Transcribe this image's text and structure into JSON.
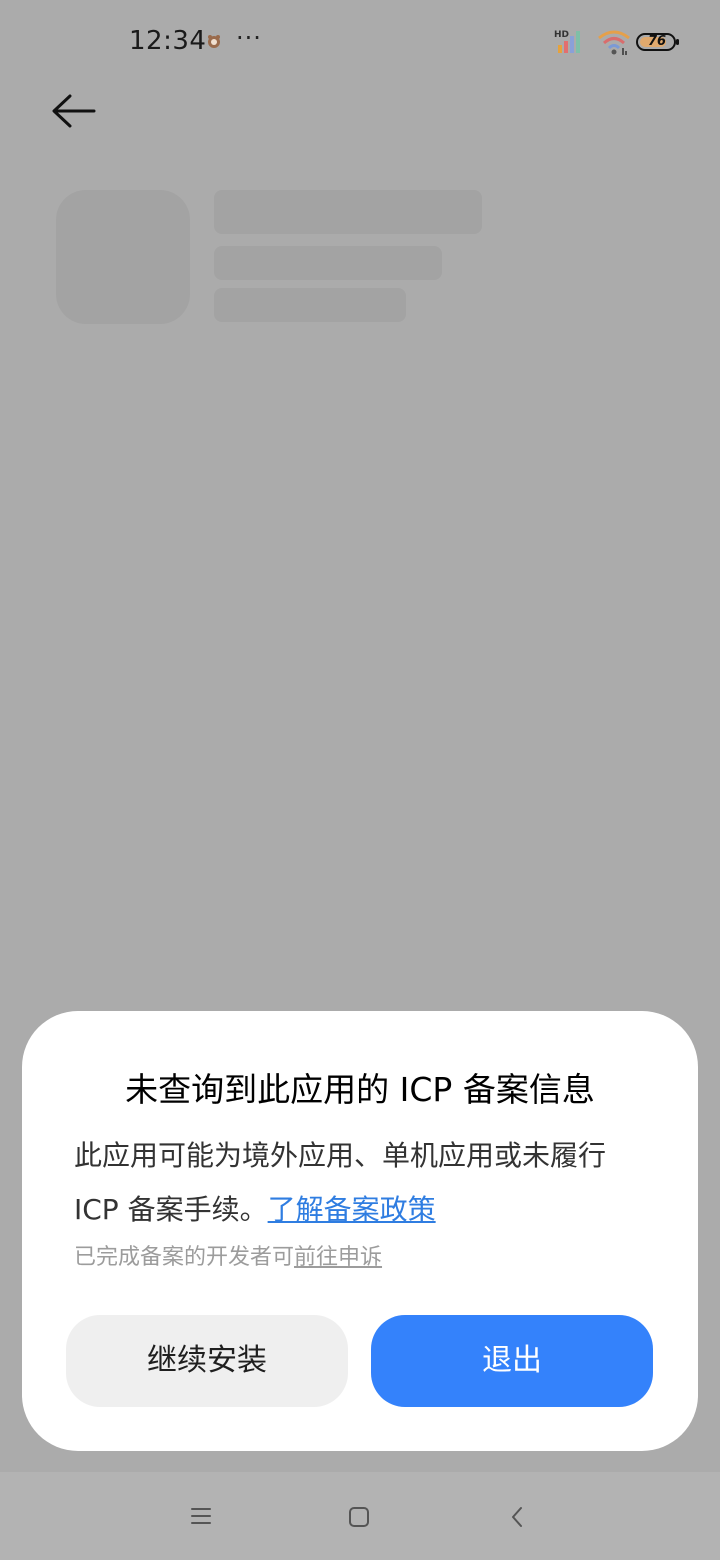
{
  "status_bar": {
    "time": "12:34",
    "more": "···",
    "network_label": "HD",
    "battery_level": "76",
    "icons": [
      "notification-icon",
      "signal-icon",
      "wifi-icon",
      "battery-icon"
    ]
  },
  "header": {
    "back_icon": "arrow-left-icon"
  },
  "dialog": {
    "title": "未查询到此应用的 ICP 备案信息",
    "message": "此应用可能为境外应用、单机应用或未履行 ICP 备案手续。",
    "policy_link": "了解备案政策",
    "footnote": "已完成备案的开发者可",
    "appeal_link": "前往申诉",
    "continue_button": "继续安装",
    "exit_button": "退出",
    "colors": {
      "link": "#2f7de1",
      "primary_button": "#3482fb",
      "secondary_button": "#efefef"
    }
  },
  "nav_bar": {
    "icons": [
      "menu-icon",
      "home-icon",
      "back-icon"
    ]
  }
}
